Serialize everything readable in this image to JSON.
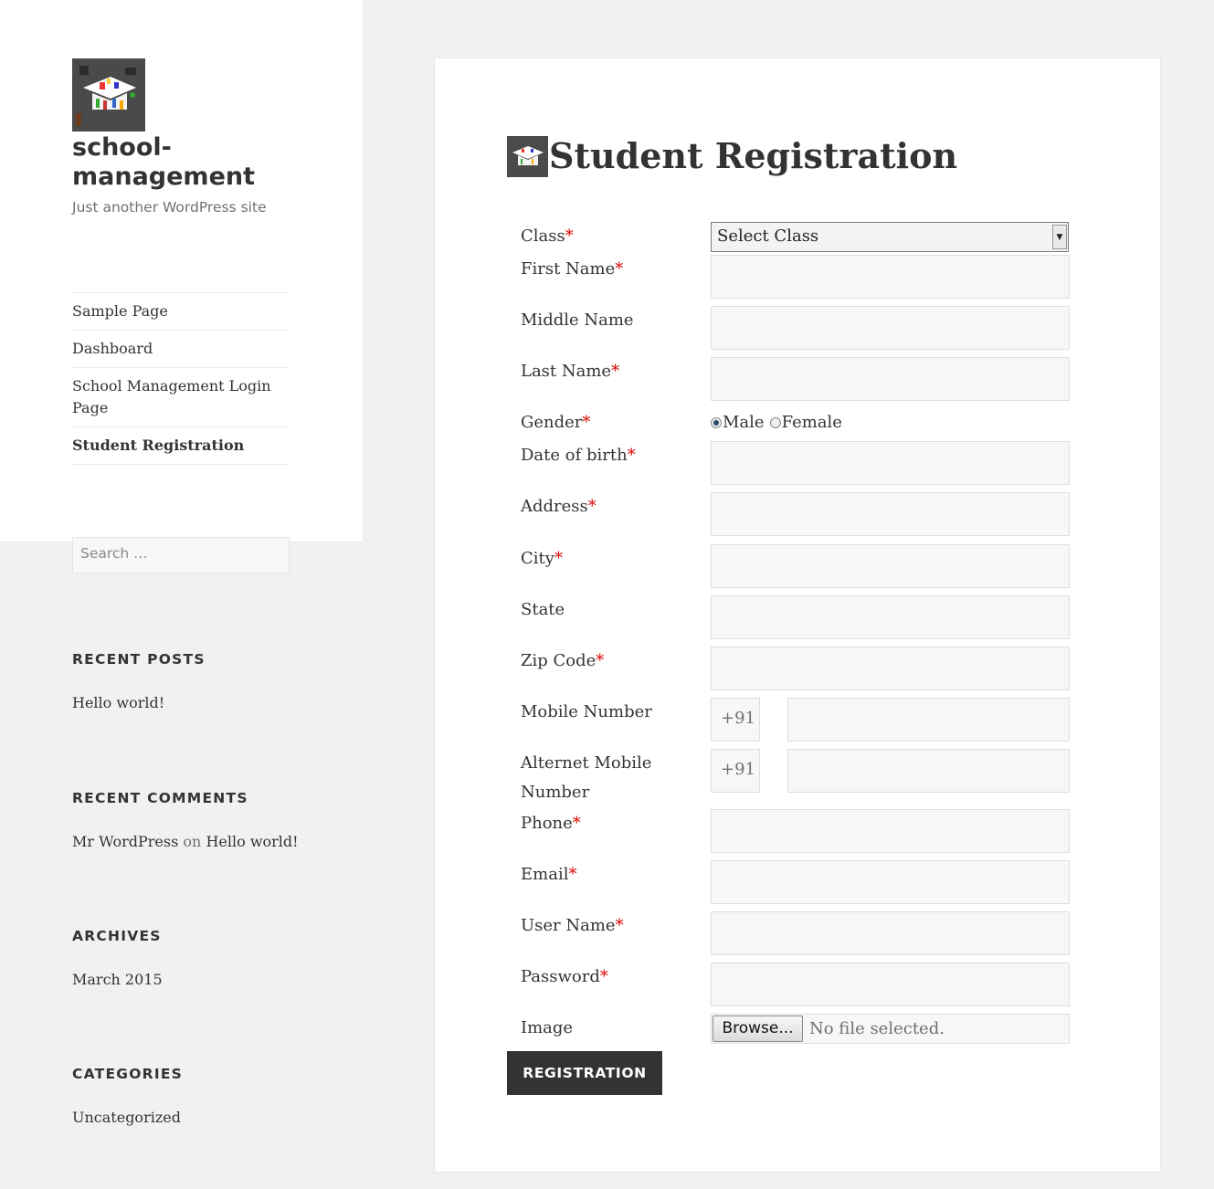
{
  "site": {
    "title": "school-management",
    "description": "Just another WordPress site"
  },
  "nav": {
    "items": [
      {
        "label": "Sample Page"
      },
      {
        "label": "Dashboard"
      },
      {
        "label": "School Management Login Page"
      },
      {
        "label": "Student Registration",
        "current": true
      }
    ]
  },
  "search": {
    "placeholder": "Search …"
  },
  "widgets": {
    "recent_posts": {
      "title": "RECENT POSTS",
      "items": [
        "Hello world!"
      ]
    },
    "recent_comments": {
      "title": "RECENT COMMENTS",
      "author": "Mr WordPress",
      "on": "on",
      "post": "Hello world!"
    },
    "archives": {
      "title": "ARCHIVES",
      "items": [
        "March 2015"
      ]
    },
    "categories": {
      "title": "CATEGORIES",
      "items": [
        "Uncategorized"
      ]
    }
  },
  "page": {
    "title": "Student Registration"
  },
  "form": {
    "class_label": "Class",
    "class_selected": "Select Class",
    "first_name": "First Name",
    "middle_name": "Middle Name",
    "last_name": "Last Name",
    "gender": "Gender",
    "gender_male": "Male",
    "gender_female": "Female",
    "dob": "Date of birth",
    "address": "Address",
    "city": "City",
    "state": "State",
    "zip": "Zip Code",
    "mobile": "Mobile Number",
    "alt_mobile": "Alternet Mobile Number",
    "country_code": "+91",
    "phone": "Phone",
    "email": "Email",
    "username": "User Name",
    "password": "Password",
    "image": "Image",
    "browse": "Browse...",
    "file_status": "No file selected.",
    "required_mark": "*",
    "submit": "Registration"
  },
  "colors": {
    "required": "#dd0000",
    "button_bg": "#333333",
    "page_bg": "#f1f1f1"
  }
}
